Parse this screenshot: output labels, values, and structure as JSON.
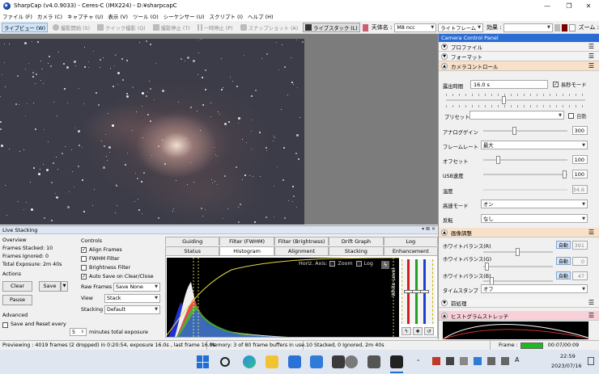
{
  "titlebar": {
    "title": "SharpCap (v4.0.9033) - Ceres-C (IMX224) - D:¥sharpcapC",
    "minimize": "—",
    "restore": "❐",
    "close": "✕"
  },
  "menu": [
    "ファイル (F)",
    "カメラ (C)",
    "キャプチャ (U)",
    "表示 (V)",
    "ツール (O)",
    "シーケンサー (U)",
    "スクリプト (I)",
    "ヘルプ (H)"
  ],
  "toolbar": {
    "live_view": "ライブビュー (W)",
    "capture": "撮影開始 (S)",
    "quick_capture": "クイック撮影 (Q)",
    "stop": "撮影停止 (T)",
    "pause": "一時停止 (P)",
    "snapshot": "スナップショット (A)",
    "live_stack": "ライブスタック (L)",
    "target_label": "天体名 :",
    "target_value": "M8 ncc",
    "frame_mode": "ライトフレーム",
    "effect_label": "効果 :",
    "zoom_label": "ズーム :"
  },
  "live_stacking": {
    "header": "Live Stacking",
    "header_btns": "▾ ⊠ ✕",
    "overview_label": "Overview",
    "frames_stacked": "Frames Stacked: 10",
    "frames_ignored": "Frames Ignored: 0",
    "total_exposure": "Total Exposure:  2m 40s",
    "actions_label": "Actions",
    "clear": "Clear",
    "save": "Save",
    "pause": "Pause",
    "advanced_label": "Advanced",
    "save_reset": "Save and Reset every",
    "save_reset_value": "5",
    "save_reset_unit": "minutes total exposure",
    "controls_label": "Controls",
    "align_frames": "Align Frames",
    "fwhm_filter": "FWHM Filter",
    "brightness_filter": "Brightness Filter",
    "auto_save": "Auto Save on Clear/Close",
    "raw_frames_label": "Raw Frames",
    "raw_frames_value": "Save None",
    "view_label": "View",
    "view_value": "Stack",
    "stacking_label": "Stacking",
    "stacking_value": "Default",
    "tabs_top": [
      "Guiding",
      "Filter (FWHM)",
      "Filter (Brightness)",
      "Drift Graph",
      "Log"
    ],
    "tabs_bottom": [
      "Status",
      "Histogram",
      "Alignment",
      "Stacking",
      "Enhancement"
    ],
    "horiz_axis": "Horiz. Axis:",
    "zoom": "Zoom",
    "log": "Log",
    "white_level": "White Level"
  },
  "camera_panel": {
    "title": "Camera Control Panel",
    "profile": "プロファイル",
    "format": "フォーマット",
    "camera_control": "カメラコントロール",
    "exposure_label": "露出時間",
    "exposure_value": "16.0 s",
    "long_exposure": "長秒モード",
    "preset_label": "プリセット",
    "auto": "自動",
    "analog_gain_label": "アナログゲイン",
    "analog_gain_value": "300",
    "frame_rate_label": "フレームレート",
    "frame_rate_value": "最大",
    "offset_label": "オフセット",
    "offset_value": "100",
    "usb_label": "USB速度",
    "usb_value": "100",
    "temp_label": "温度",
    "temp_value": "34.6",
    "highspeed_label": "高速モード",
    "highspeed_value": "オン",
    "flip_label": "反転",
    "flip_value": "なし",
    "image_adjust": "画像調整",
    "wb_r_label": "ホワイトバランス(R)",
    "wb_r_value": "391",
    "wb_g_label": "ホワイトバランス(G)",
    "wb_g_value": "0",
    "wb_b_label": "ホワイトバランス(B)",
    "wb_b_value": "47",
    "timestamp_label": "タイムスタンプ",
    "timestamp_value": "オフ",
    "preprocess": "前処理",
    "histogram_stretch": "ヒストグラムストレッチ"
  },
  "statusbar": {
    "preview": "Previewing : 4019 frames (2 dropped) in 0:20:54, exposure 16.0s , last frame 16.0s",
    "memory": "Memory: 3 of 80 frame buffers in use.",
    "stacked": "10 Stacked, 0 Ignored, 2m 40s",
    "frame_label": "Frame :",
    "frame_time": "00:07/00:09"
  },
  "taskbar": {
    "time": "22:59",
    "date": "2023/07/16",
    "lang": "A"
  }
}
